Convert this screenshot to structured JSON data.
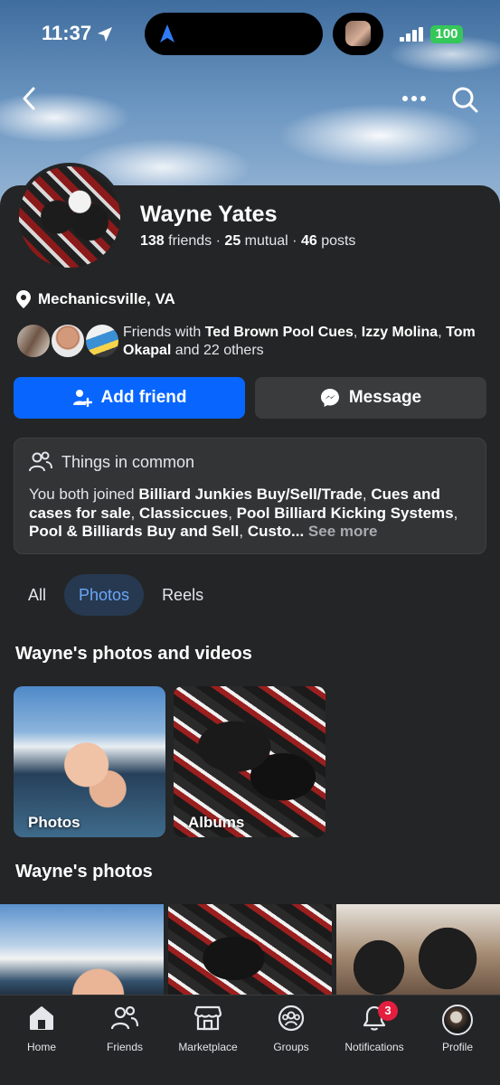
{
  "status_bar": {
    "time": "11:37",
    "battery": "100"
  },
  "profile": {
    "name": "Wayne Yates",
    "friends_count": "138",
    "friends_label": "friends",
    "mutual_count": "25",
    "mutual_label": "mutual",
    "posts_count": "46",
    "posts_label": "posts",
    "separator": "·",
    "location": "Mechanicsville, VA"
  },
  "mutual_friends": {
    "prefix": "Friends with ",
    "name1": "Ted Brown Pool Cues",
    "sep1": ", ",
    "name2": "Izzy Molina",
    "sep2": ",",
    "name3": "Tom Okapal",
    "suffix": " and 22 others"
  },
  "actions": {
    "add_friend": "Add friend",
    "message": "Message"
  },
  "things_in_common": {
    "title": "Things in common",
    "prefix": "You both joined ",
    "group1": "Billiard Junkies Buy/Sell/Trade",
    "sep1": ", ",
    "group2": "Cues and cases for sale",
    "sep2": ", ",
    "group3": "Classiccues",
    "sep3": ", ",
    "group4": "Pool Billiard Kicking Systems",
    "sep4": ", ",
    "group5": "Pool & Billiards Buy and Sell",
    "sep5": ", ",
    "group6": "Custo...",
    "see_more": "See more"
  },
  "tabs": {
    "all": "All",
    "photos": "Photos",
    "reels": "Reels"
  },
  "sections": {
    "photos_videos_title": "Wayne's photos and videos",
    "photos_card": "Photos",
    "albums_card": "Albums",
    "photos_title": "Wayne's photos"
  },
  "bottom_nav": {
    "home": "Home",
    "friends": "Friends",
    "marketplace": "Marketplace",
    "groups": "Groups",
    "notifications": "Notifications",
    "notifications_badge": "3",
    "profile": "Profile"
  },
  "colors": {
    "accent": "#0866ff",
    "active_tab_bg": "#263951",
    "active_tab_text": "#6aa6f8",
    "badge": "#e41e3f"
  }
}
